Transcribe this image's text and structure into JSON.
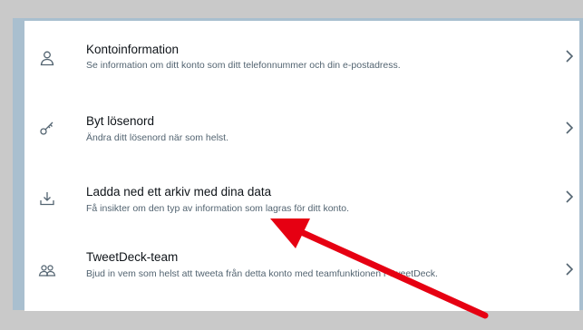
{
  "colors": {
    "annotation_arrow": "#e60012",
    "icon": "#536471",
    "text_primary": "#0f1419",
    "text_secondary": "#536471"
  },
  "settings": {
    "items": [
      {
        "icon": "person-icon",
        "title": "Kontoinformation",
        "description": "Se information om ditt konto som ditt telefonnummer och din e-postadress."
      },
      {
        "icon": "key-icon",
        "title": "Byt lösenord",
        "description": "Ändra ditt lösenord när som helst."
      },
      {
        "icon": "download-icon",
        "title": "Ladda ned ett arkiv med dina data",
        "description": "Få insikter om den typ av information som lagras för ditt konto."
      },
      {
        "icon": "team-icon",
        "title": "TweetDeck-team",
        "description": "Bjud in vem som helst att tweeta från detta konto med teamfunktionen i TweetDeck."
      }
    ]
  }
}
